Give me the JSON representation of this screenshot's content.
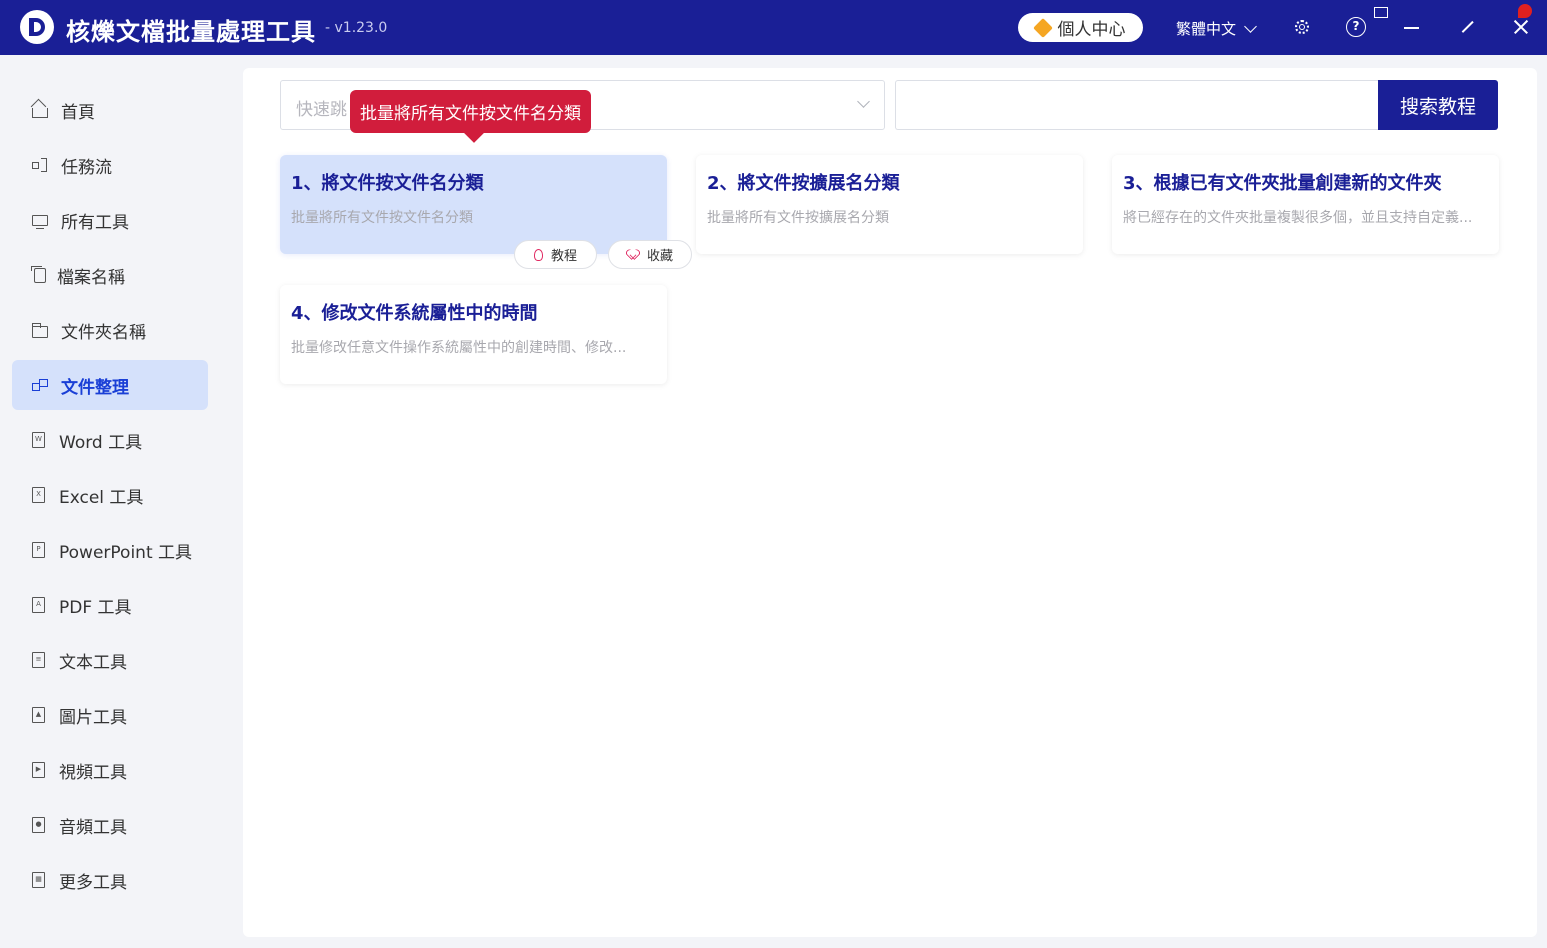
{
  "titlebar": {
    "app_title": "核爍文檔批量處理工具",
    "version": "- v1.23.0",
    "user_center": "個人中心",
    "language": "繁體中文",
    "help_glyph": "?"
  },
  "sidebar": {
    "items": [
      {
        "label": "首頁",
        "icon": "home-icon"
      },
      {
        "label": "任務流",
        "icon": "flow-icon"
      },
      {
        "label": "所有工具",
        "icon": "monitor-icon"
      },
      {
        "label": "檔案名稱",
        "icon": "files-icon"
      },
      {
        "label": "文件夾名稱",
        "icon": "folder-icon"
      },
      {
        "label": "文件整理",
        "icon": "organize-icon",
        "active": true
      },
      {
        "label": "Word 工具",
        "icon": "word-icon",
        "glyph": "W"
      },
      {
        "label": "Excel 工具",
        "icon": "excel-icon",
        "glyph": "X"
      },
      {
        "label": "PowerPoint 工具",
        "icon": "powerpoint-icon",
        "glyph": "P"
      },
      {
        "label": "PDF 工具",
        "icon": "pdf-icon",
        "glyph": "A"
      },
      {
        "label": "文本工具",
        "icon": "text-icon",
        "glyph": "≡"
      },
      {
        "label": "圖片工具",
        "icon": "image-icon",
        "glyph": "▲"
      },
      {
        "label": "視頻工具",
        "icon": "video-icon",
        "glyph": "▶"
      },
      {
        "label": "音頻工具",
        "icon": "mic-icon",
        "glyph": "●"
      },
      {
        "label": "更多工具",
        "icon": "grid-icon",
        "glyph": "▦"
      }
    ]
  },
  "search": {
    "quick_placeholder": "快速跳",
    "search_button": "搜索教程"
  },
  "tooltip": "批量將所有文件按文件名分類",
  "cards": [
    {
      "title": "1、將文件按文件名分類",
      "desc": "批量將所有文件按文件名分類"
    },
    {
      "title": "2、將文件按擴展名分類",
      "desc": "批量將所有文件按擴展名分類"
    },
    {
      "title": "3、根據已有文件夾批量創建新的文件夾",
      "desc": "將已經存在的文件夾批量複製很多個，並且支持自定義..."
    },
    {
      "title": "4、修改文件系統屬性中的時間",
      "desc": "批量修改任意文件操作系統屬性中的創建時間、修改..."
    }
  ],
  "card_actions": {
    "tutorial": "教程",
    "favorite": "收藏"
  },
  "colors": {
    "brand": "#1a1f96",
    "active_bg": "#d5e1fb",
    "active_text": "#1a3fd6",
    "tooltip": "#d11d3c"
  }
}
